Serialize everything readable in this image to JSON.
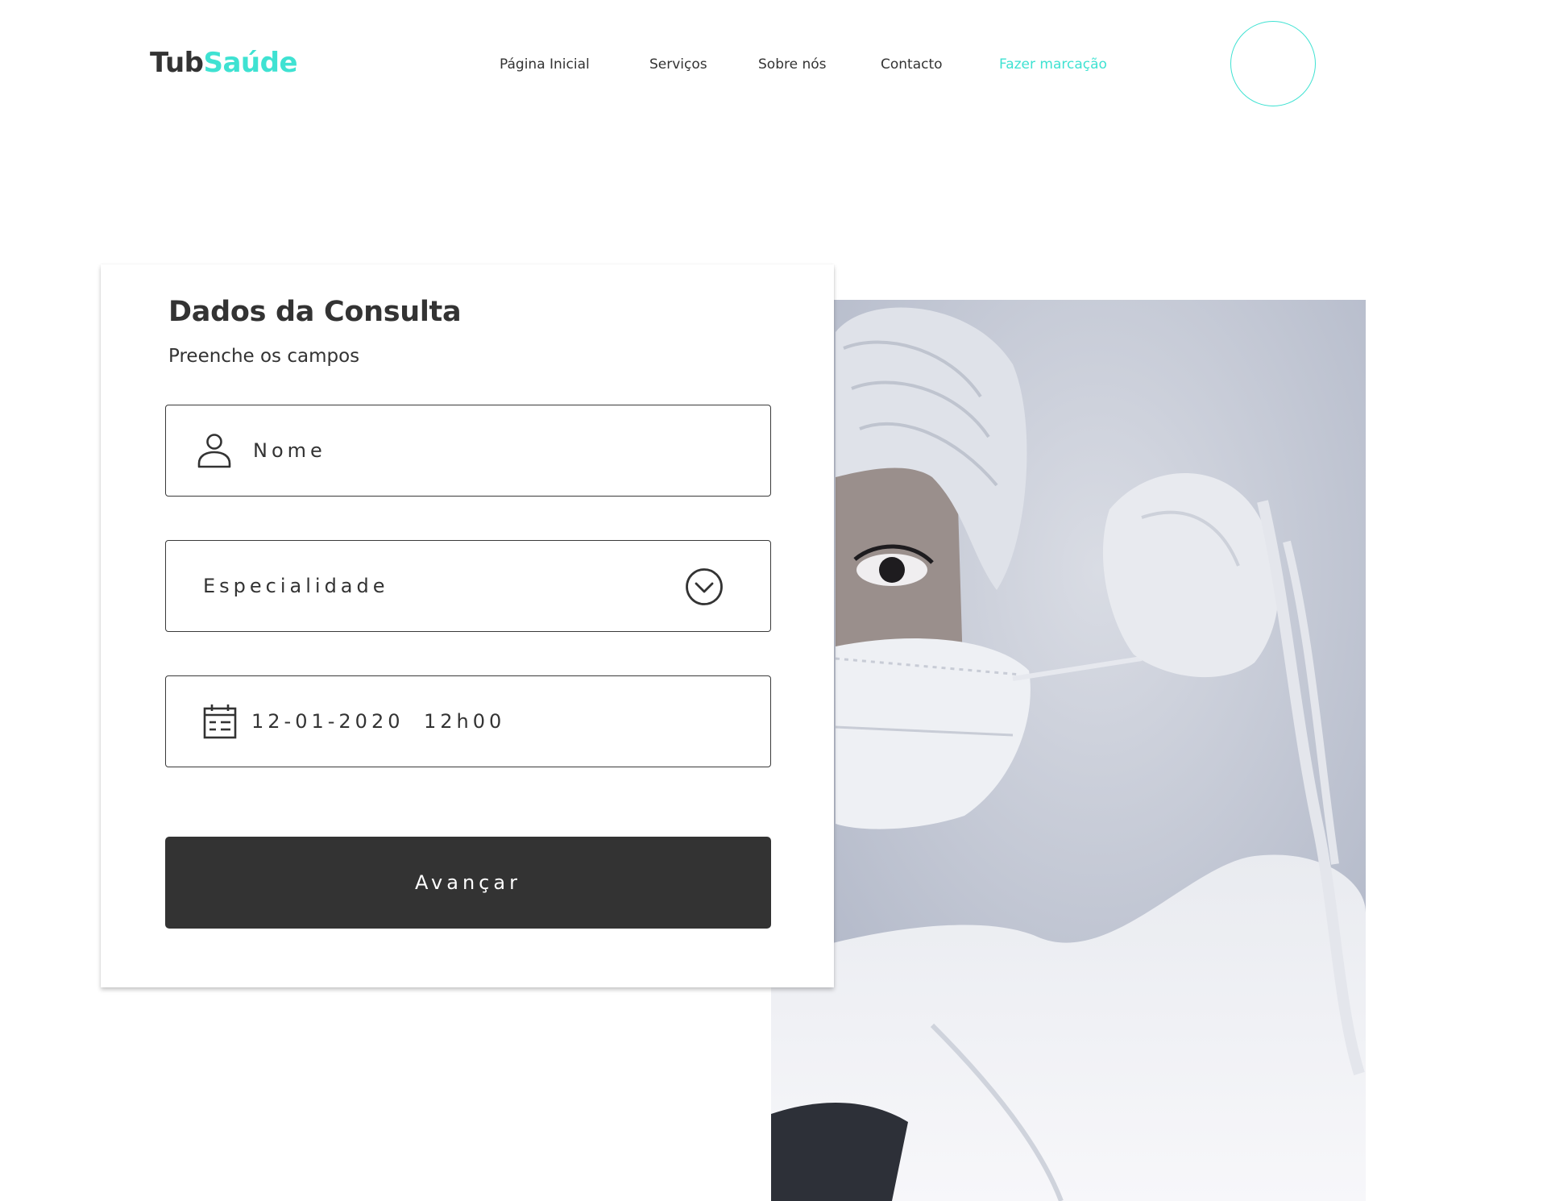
{
  "brand": {
    "name_part1": "Tub",
    "name_part2": "Saúde",
    "accent_color": "#3fe2d2",
    "text_color": "#333333"
  },
  "nav": {
    "items": [
      {
        "label": "Página Inicial",
        "active": false
      },
      {
        "label": "Serviços",
        "active": false
      },
      {
        "label": "Sobre nós",
        "active": false
      },
      {
        "label": "Contacto",
        "active": false
      },
      {
        "label": "Fazer marcação",
        "active": true
      }
    ],
    "profile_icon": "circle-outline"
  },
  "form": {
    "title": "Dados da Consulta",
    "subtitle": "Preenche os campos",
    "name_field": {
      "placeholder": "Nome",
      "icon": "user-icon"
    },
    "specialty_field": {
      "placeholder": "Especialidade",
      "icon": "chevron-down-circle-icon"
    },
    "datetime_field": {
      "date": "12-01-2020",
      "time": "12h00",
      "icon": "calendar-icon"
    },
    "submit_label": "Avançar",
    "button_color": "#333333"
  },
  "hero_image": {
    "subject": "medical professional putting on a face mask",
    "icon": "photo"
  }
}
